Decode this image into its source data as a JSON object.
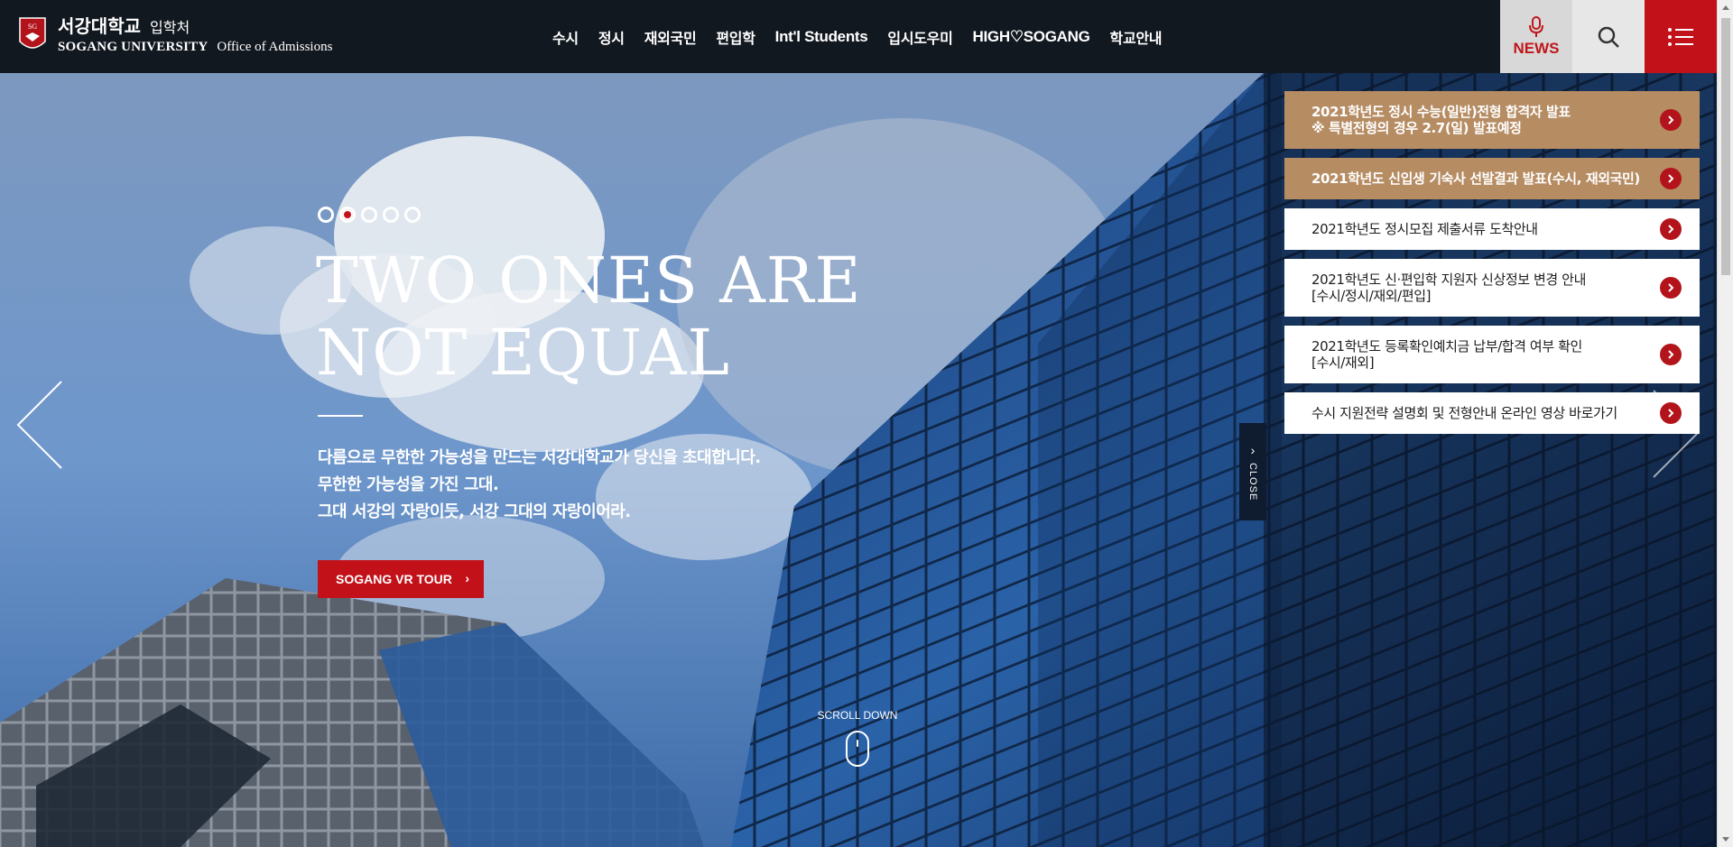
{
  "header": {
    "logo": {
      "korean_name": "서강대학교",
      "office_ko": "입학처",
      "university_en": "SOGANG UNIVERSITY",
      "office_en": "Office of Admissions"
    },
    "nav": [
      {
        "label": "수시",
        "latin": false
      },
      {
        "label": "정시",
        "latin": false
      },
      {
        "label": "재외국민",
        "latin": false
      },
      {
        "label": "편입학",
        "latin": false
      },
      {
        "label": "Int'l Students",
        "latin": true
      },
      {
        "label": "입시도우미",
        "latin": false
      },
      {
        "label": "HIGH♡SOGANG",
        "latin": true
      },
      {
        "label": "학교안내",
        "latin": false
      }
    ],
    "news_label": "NEWS",
    "icons": {
      "news": "microphone-icon",
      "search": "search-icon",
      "menu": "list-menu-icon"
    }
  },
  "hero": {
    "slides_total": 5,
    "active_slide": 2,
    "headline_line1": "TWO ONES ARE",
    "headline_line2": "NOT EQUAL",
    "subtext": [
      "다름으로 무한한 가능성을 만드는 서강대학교가 당신을 초대합니다.",
      "무한한 가능성을 가진 그대.",
      "그대 서강의 자랑이듯, 서강 그대의 자랑이어라."
    ],
    "vr_button": "SOGANG VR TOUR",
    "scroll_label": "SCROLL DOWN",
    "close_label": "CLOSE"
  },
  "notices": [
    {
      "style": "gold",
      "lines": [
        "2021학년도 정시 수능(일반)전형 합격자 발표",
        "※ 특별전형의 경우 2.7(일) 발표예정"
      ]
    },
    {
      "style": "gold",
      "lines": [
        "2021학년도 신입생 기숙사 선발결과 발표(수시, 재외국민)"
      ]
    },
    {
      "style": "white",
      "lines": [
        "2021학년도 정시모집 제출서류 도착안내"
      ]
    },
    {
      "style": "white",
      "lines": [
        "2021학년도 신·편입학 지원자 신상정보 변경 안내",
        "[수시/정시/재외/편입]"
      ]
    },
    {
      "style": "white",
      "lines": [
        "2021학년도 등록확인예치금 납부/합격 여부 확인",
        "[수시/재외]"
      ]
    },
    {
      "style": "white",
      "lines": [
        "수시 지원전략 설명회 및 전형안내 온라인 영상 바로가기"
      ]
    }
  ],
  "colors": {
    "brand_red": "#c3111a",
    "header_bg": "#121820",
    "notice_gold": "#b68c63"
  }
}
